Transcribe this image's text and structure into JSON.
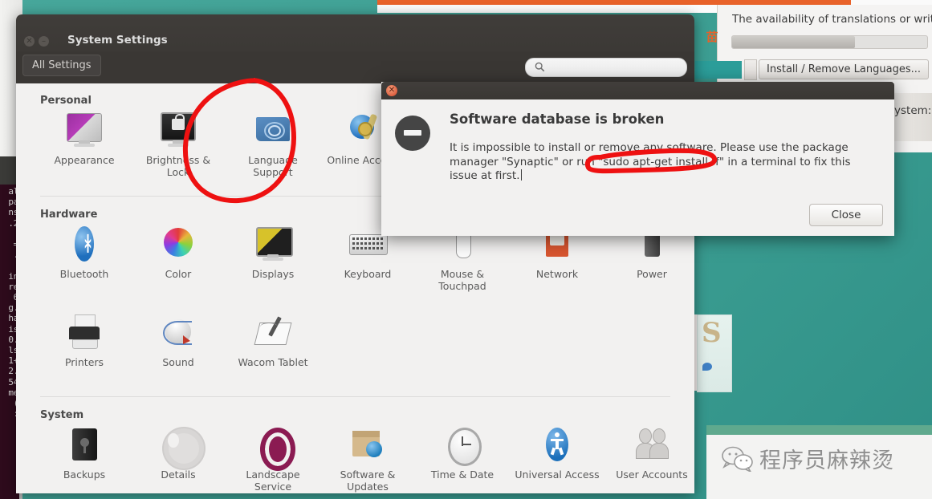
{
  "window": {
    "title": "System Settings",
    "all_settings_label": "All Settings",
    "close_icon": "window-close-icon",
    "minimize_icon": "window-minimize-icon",
    "search_placeholder": "",
    "search_value": ""
  },
  "sections": [
    {
      "title": "Personal",
      "items": [
        {
          "label": "Appearance",
          "icon": "appearance-icon"
        },
        {
          "label": "Brightness & Lock",
          "icon": "brightness-lock-icon"
        },
        {
          "label": "Language Support",
          "icon": "language-support-icon"
        },
        {
          "label": "Online Accounts",
          "icon": "online-accounts-icon"
        }
      ]
    },
    {
      "title": "Hardware",
      "items": [
        {
          "label": "Bluetooth",
          "icon": "bluetooth-icon"
        },
        {
          "label": "Color",
          "icon": "color-icon"
        },
        {
          "label": "Displays",
          "icon": "displays-icon"
        },
        {
          "label": "Keyboard",
          "icon": "keyboard-icon"
        },
        {
          "label": "Mouse & Touchpad",
          "icon": "mouse-touchpad-icon"
        },
        {
          "label": "Network",
          "icon": "network-icon"
        },
        {
          "label": "Power",
          "icon": "power-icon"
        },
        {
          "label": "Printers",
          "icon": "printers-icon"
        },
        {
          "label": "Sound",
          "icon": "sound-icon"
        },
        {
          "label": "Wacom Tablet",
          "icon": "wacom-tablet-icon"
        }
      ]
    },
    {
      "title": "System",
      "items": [
        {
          "label": "Backups",
          "icon": "backups-icon"
        },
        {
          "label": "Details",
          "icon": "details-icon"
        },
        {
          "label": "Landscape Service",
          "icon": "landscape-service-icon"
        },
        {
          "label": "Software & Updates",
          "icon": "software-updates-icon"
        },
        {
          "label": "Time & Date",
          "icon": "time-date-icon"
        },
        {
          "label": "Universal Access",
          "icon": "universal-access-icon"
        },
        {
          "label": "User Accounts",
          "icon": "user-accounts-icon"
        }
      ]
    }
  ],
  "dialog": {
    "heading": "Software database is broken",
    "body": "It is impossible to install or remove any software. Please use the package manager \"Synaptic\" or run \"sudo apt-get install -f\" in a terminal to fix this issue at first.",
    "close_button": "Close",
    "close_icon": "dialog-close-icon",
    "status_icon": "error-stop-icon"
  },
  "language_window": {
    "description": "The availability of translations or writ",
    "install_remove_label": "Install / Remove Languages...",
    "progress_percent": 63,
    "system_fragment": "ystem:"
  },
  "watermark": {
    "text": "程序员麻辣烫",
    "icon": "wechat-icon"
  },
  "terminal": {
    "lines": "al\npa\nns\n.2\n\n=\n.\n\nin\nre\n6\ng.\nha\nis\n0.\nls\n1+\n2.\n54\nme\n(\n:"
  },
  "annotations": {
    "ellipse_label": "red-circle-language-support",
    "ellipse_cmd_label": "red-circle-apt-command",
    "color": "#ee1111"
  }
}
